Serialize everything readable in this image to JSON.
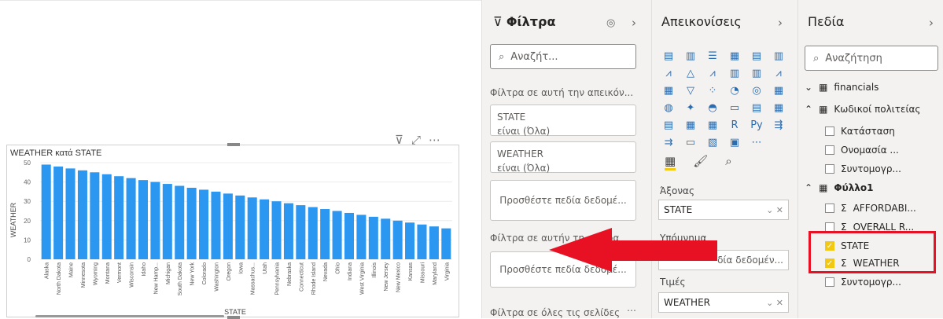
{
  "filters": {
    "title": "Φίλτρα",
    "search_placeholder": "Αναζήτ...",
    "visual_section": "Φίλτρα σε αυτή την απεικόν...",
    "cards": [
      {
        "field": "STATE",
        "value": "είναι (Όλα)"
      },
      {
        "field": "WEATHER",
        "value": "είναι (Όλα)"
      }
    ],
    "add_fields": "Προσθέστε πεδία δεδομέ...",
    "page_section": "Φίλτρα σε αυτήν τη σελίδα",
    "page_add_fields": "Προσθέστε πεδία δεδομέ...",
    "all_pages_section": "Φίλτρα σε όλες τις σελίδες"
  },
  "visualizations": {
    "title": "Απεικονίσεις",
    "axis_label": "Άξονας",
    "axis_value": "STATE",
    "legend_label": "Υπόμνημα",
    "legend_placeholder": "δία δεδομέν...",
    "values_label": "Τιμές",
    "values_value": "WEATHER"
  },
  "fields": {
    "title": "Πεδία",
    "search_placeholder": "Αναζήτηση",
    "items": [
      {
        "label": "financials",
        "type": "table",
        "checked": false
      },
      {
        "label": "Κωδικοί πολιτείας",
        "type": "table",
        "checked": false
      },
      {
        "label": "Κατάσταση",
        "type": "field",
        "checked": false
      },
      {
        "label": "Ονομασία ...",
        "type": "field",
        "checked": false
      },
      {
        "label": "Συντομογρ...",
        "type": "field",
        "checked": false
      },
      {
        "label": "Φύλλο1",
        "type": "table",
        "checked": false
      },
      {
        "label": "AFFORDABI...",
        "type": "measure",
        "checked": false
      },
      {
        "label": "OVERALL R...",
        "type": "measure",
        "checked": false
      },
      {
        "label": "STATE",
        "type": "field",
        "checked": true
      },
      {
        "label": "WEATHER",
        "type": "measure",
        "checked": true
      },
      {
        "label": "Συντομογρ...",
        "type": "field",
        "checked": false
      }
    ]
  },
  "colors": {
    "bar": "#2b97f0",
    "arrow": "#e81123",
    "highlight": "#e81123",
    "check": "#f2c811"
  },
  "chart_data": {
    "type": "bar",
    "title": "WEATHER κατά STATE",
    "xlabel": "STATE",
    "ylabel": "WEATHER",
    "ylim": [
      0,
      50
    ],
    "yticks": [
      0,
      10,
      20,
      30,
      40,
      50
    ],
    "categories": [
      "Alaska",
      "North Dakota",
      "Maine",
      "Minnesota",
      "Wyoming",
      "Montana",
      "Vermont",
      "Wisconsin",
      "Idaho",
      "New Hamp...",
      "Michigan",
      "South Dakota",
      "New York",
      "Colorado",
      "Washington",
      "Oregon",
      "Iowa",
      "Massachus...",
      "Utah",
      "Pennsylvania",
      "Nebraska",
      "Connecticut",
      "Rhode Island",
      "Nevada",
      "Ohio",
      "Indiana",
      "West Virginia",
      "Illinois",
      "New Jersey",
      "New Mexico",
      "Kansas",
      "Missouri",
      "Maryland",
      "Virginia"
    ],
    "values": [
      49,
      48,
      47,
      46,
      45,
      44,
      43,
      42,
      41,
      40,
      39,
      38,
      37,
      36,
      35,
      34,
      33,
      32,
      31,
      30,
      29,
      28,
      27,
      26,
      25,
      24,
      23,
      22,
      21,
      20,
      19,
      18,
      17,
      16
    ]
  }
}
